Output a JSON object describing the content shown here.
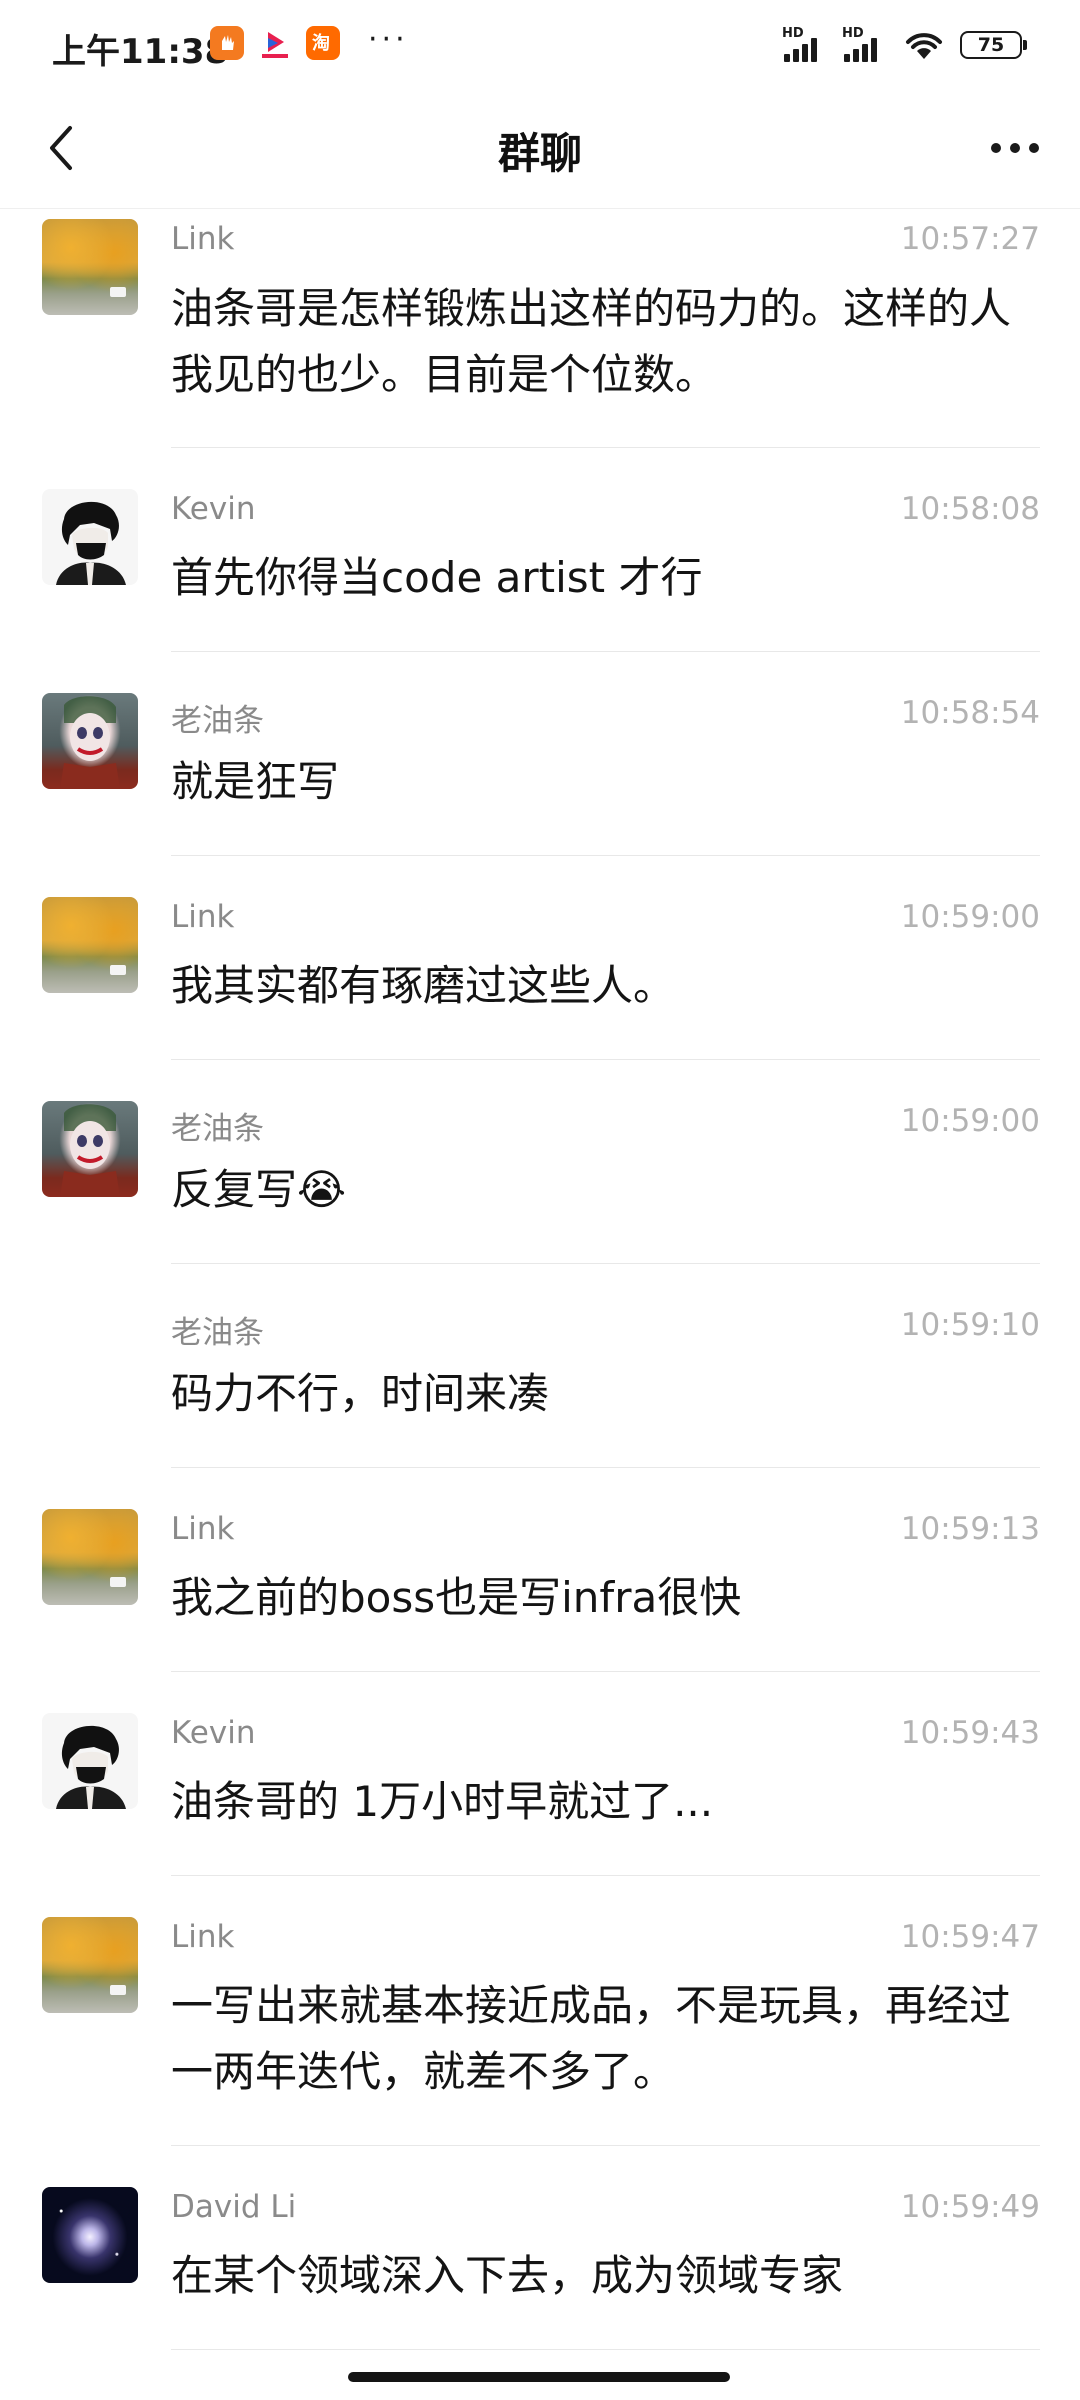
{
  "status_bar": {
    "time": "上午11:38",
    "app_icons": [
      "orange-app-icon",
      "video-app-icon",
      "taobao-icon"
    ],
    "more": "···",
    "network_labels": [
      "HD",
      "HD"
    ],
    "battery": "75"
  },
  "nav": {
    "title": "群聊"
  },
  "messages": [
    {
      "sender": "Link",
      "time": "10:57:27",
      "text": "油条哥是怎样锻炼出这样的码力的。这样的人我见的也少。目前是个位数。",
      "avatar": "link-avatar"
    },
    {
      "sender": "Kevin",
      "time": "10:58:08",
      "text": "首先你得当code artist 才行",
      "avatar": "kevin-avatar"
    },
    {
      "sender": "老油条",
      "time": "10:58:54",
      "text": "就是狂写",
      "avatar": "joker-avatar"
    },
    {
      "sender": "Link",
      "time": "10:59:00",
      "text": "我其实都有琢磨过这些人。",
      "avatar": "link-avatar"
    },
    {
      "sender": "老油条",
      "time": "10:59:00",
      "text": "反复写",
      "emoji": "😭",
      "avatar": "joker-avatar"
    },
    {
      "sender": "老油条",
      "time": "10:59:10",
      "text": "码力不行，时间来凑",
      "avatar": ""
    },
    {
      "sender": "Link",
      "time": "10:59:13",
      "text": "我之前的boss也是写infra很快",
      "avatar": "link-avatar"
    },
    {
      "sender": "Kevin",
      "time": "10:59:43",
      "text": "油条哥的 1万小时早就过了...",
      "avatar": "kevin-avatar"
    },
    {
      "sender": "Link",
      "time": "10:59:47",
      "text": "一写出来就基本接近成品，不是玩具，再经过一两年迭代，就差不多了。",
      "avatar": "link-avatar"
    },
    {
      "sender": "David Li",
      "time": "10:59:49",
      "text": "在某个领域深入下去，成为领域专家",
      "avatar": "david-avatar"
    }
  ]
}
